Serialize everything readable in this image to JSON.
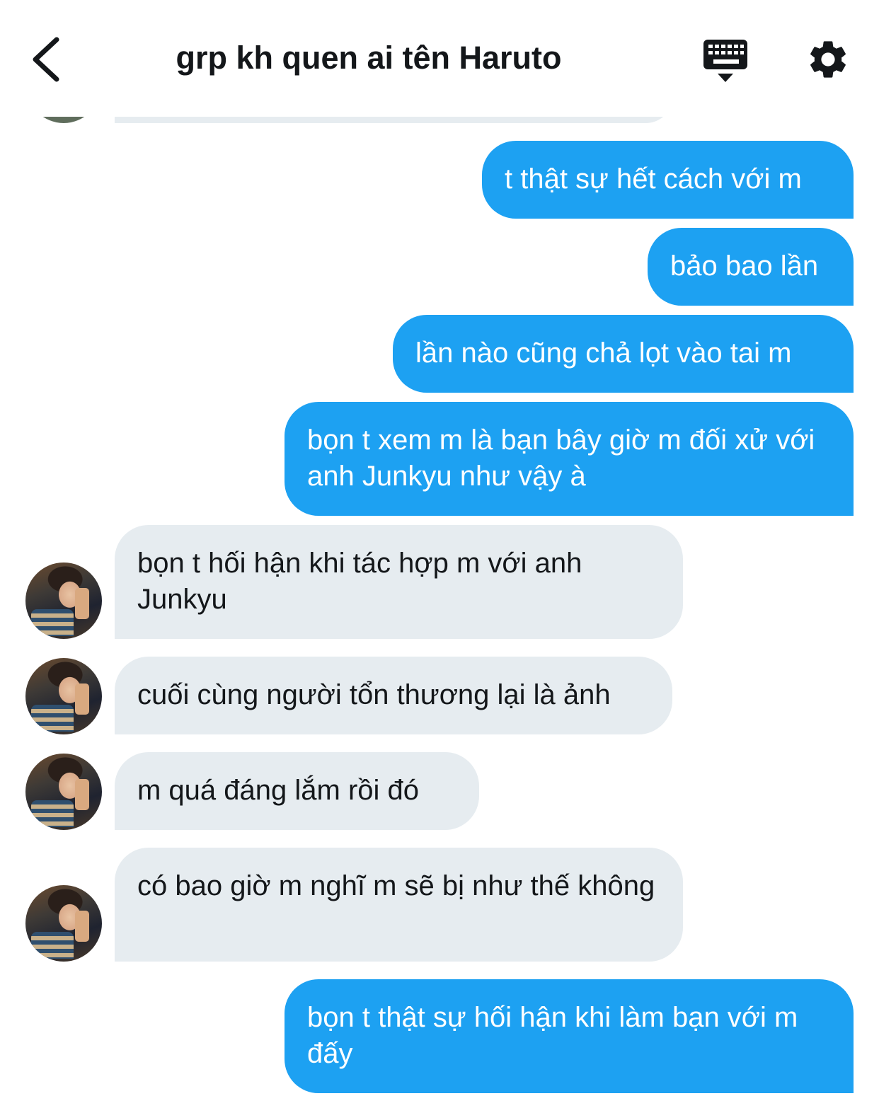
{
  "header": {
    "title": "grp kh quen ai tên Haruto"
  },
  "icons": {
    "back": "chevron-left-icon",
    "keyboard": "keyboard-icon",
    "settings": "gear-icon"
  },
  "colors": {
    "sent_bubble": "#1da1f2",
    "received_bubble": "#e6ecf0",
    "text_dark": "#14171a"
  },
  "messages": [
    {
      "direction": "sent",
      "text": "t thật sự hết cách với m"
    },
    {
      "direction": "sent",
      "text": "bảo bao lần"
    },
    {
      "direction": "sent",
      "text": "lần nào cũng chả lọt vào tai m"
    },
    {
      "direction": "sent",
      "text": "bọn t xem m là bạn bây giờ m đối xử với anh Junkyu như vậy à"
    },
    {
      "direction": "received",
      "text": "bọn t hối hận khi tác hợp m với anh Junkyu"
    },
    {
      "direction": "received",
      "text": "cuối cùng người tổn thương lại là ảnh"
    },
    {
      "direction": "received",
      "text": "m quá đáng lắm rồi đó"
    },
    {
      "direction": "received",
      "text": "có bao giờ m nghĩ m sẽ bị như thế không"
    },
    {
      "direction": "sent",
      "text": "bọn t thật sự hối hận khi làm bạn với m đấy"
    }
  ]
}
